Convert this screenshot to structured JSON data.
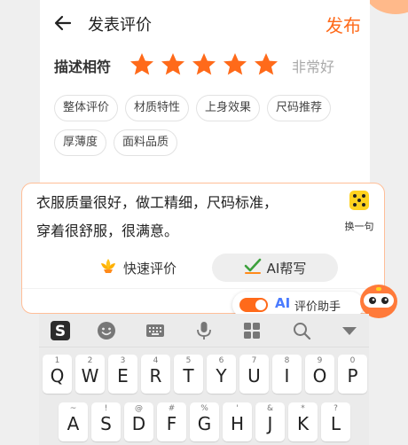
{
  "header": {
    "title": "发表评价",
    "publish_label": "发布"
  },
  "rating": {
    "label": "描述相符",
    "stars_filled": 5,
    "stars_total": 5,
    "text": "非常好",
    "color": "#ff6a1a"
  },
  "tags": [
    "整体评价",
    "材质特性",
    "上身效果",
    "尺码推荐",
    "厚薄度",
    "面料品质"
  ],
  "ai_panel": {
    "review_line1": "衣服质量很好，做工精细，尺码标准，",
    "review_line2": "穿着很舒服，很满意。",
    "shuffle_label": "换一句",
    "quick_review_label": "快速评价",
    "ai_write_label": "AI帮写",
    "assistant_ai": "AI",
    "assistant_label": "评价助手",
    "assistant_on": true
  },
  "keyboard": {
    "toolbar_icons": [
      "sogou-logo-icon",
      "emoji-icon",
      "keyboard-icon",
      "microphone-icon",
      "apps-grid-icon",
      "search-icon",
      "collapse-keyboard-icon"
    ],
    "row1": [
      {
        "letter": "Q",
        "num": "1"
      },
      {
        "letter": "W",
        "num": "2"
      },
      {
        "letter": "E",
        "num": "3"
      },
      {
        "letter": "R",
        "num": "4"
      },
      {
        "letter": "T",
        "num": "5"
      },
      {
        "letter": "Y",
        "num": "6"
      },
      {
        "letter": "U",
        "num": "7"
      },
      {
        "letter": "I",
        "num": "8"
      },
      {
        "letter": "O",
        "num": "9"
      },
      {
        "letter": "P",
        "num": "0"
      }
    ],
    "row2": [
      {
        "letter": "A",
        "num": "~"
      },
      {
        "letter": "S",
        "num": "!"
      },
      {
        "letter": "D",
        "num": "@"
      },
      {
        "letter": "F",
        "num": "#"
      },
      {
        "letter": "G",
        "num": "%"
      },
      {
        "letter": "H",
        "num": "'"
      },
      {
        "letter": "J",
        "num": "&"
      },
      {
        "letter": "K",
        "num": "*"
      },
      {
        "letter": "L",
        "num": "?"
      }
    ]
  },
  "colors": {
    "accent": "#ff6a1a",
    "ai_blue": "#4a7bff",
    "check_green": "#3ca03c"
  }
}
